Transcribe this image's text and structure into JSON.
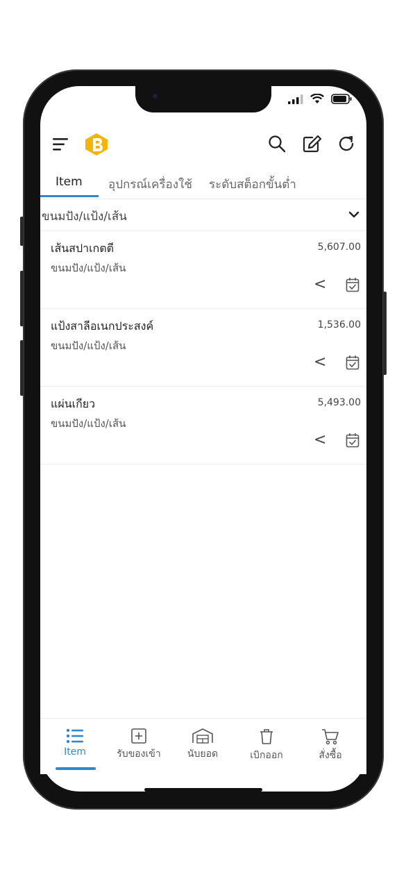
{
  "colors": {
    "accent": "#2f88ce",
    "brand": "#f5b400",
    "text": "#222222",
    "muted": "#555555"
  },
  "header": {
    "menu_icon": "menu-icon",
    "logo_icon": "brand-logo-icon",
    "tools": [
      "search-icon",
      "edit-icon",
      "refresh-icon"
    ]
  },
  "tabs": [
    {
      "label": "Item",
      "active": true
    },
    {
      "label": "อุปกรณ์เครื่องใช้",
      "active": false
    },
    {
      "label": "ระดับสต็อกขั้นต่ำ",
      "active": false
    }
  ],
  "filter": {
    "selected": "ขนมปัง/แป้ง/เส้น"
  },
  "items": [
    {
      "name": "เส้นสปาเกตตี",
      "category": "ขนมปัง/แป้ง/เส้น",
      "qty": "5,607.00",
      "action": "<"
    },
    {
      "name": "แป้งสาลีอเนกประสงค์",
      "category": "ขนมปัง/แป้ง/เส้น",
      "qty": "1,536.00",
      "action": "<"
    },
    {
      "name": "แผ่นเกียว",
      "category": "ขนมปัง/แป้ง/เส้น",
      "qty": "5,493.00",
      "action": "<"
    }
  ],
  "bottom_nav": [
    {
      "label": "Item",
      "icon": "list-icon",
      "active": true
    },
    {
      "label": "รับของเข้า",
      "icon": "plus-box-icon",
      "active": false
    },
    {
      "label": "นับยอด",
      "icon": "warehouse-icon",
      "active": false
    },
    {
      "label": "เบิกออก",
      "icon": "trash-icon",
      "active": false
    },
    {
      "label": "สั่งซื้อ",
      "icon": "cart-icon",
      "active": false
    }
  ]
}
